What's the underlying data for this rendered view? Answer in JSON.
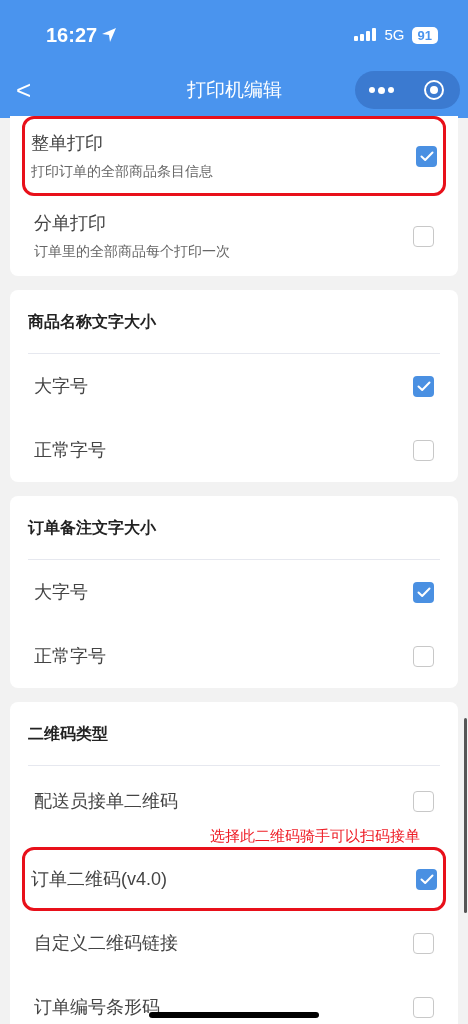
{
  "status_bar": {
    "time": "16:27",
    "network": "5G",
    "battery": "91"
  },
  "nav": {
    "back": "<",
    "title": "打印机编辑"
  },
  "sections": [
    {
      "options": [
        {
          "label": "整单打印",
          "description": "打印订单的全部商品条目信息",
          "checked": true,
          "highlighted": true
        },
        {
          "label": "分单打印",
          "description": "订单里的全部商品每个打印一次",
          "checked": false,
          "highlighted": false
        }
      ]
    },
    {
      "title": "商品名称文字大小",
      "options": [
        {
          "label": "大字号",
          "checked": true,
          "highlighted": false
        },
        {
          "label": "正常字号",
          "checked": false,
          "highlighted": false
        }
      ]
    },
    {
      "title": "订单备注文字大小",
      "options": [
        {
          "label": "大字号",
          "checked": true,
          "highlighted": false
        },
        {
          "label": "正常字号",
          "checked": false,
          "highlighted": false
        }
      ]
    },
    {
      "title": "二维码类型",
      "options": [
        {
          "label": "配送员接单二维码",
          "checked": false,
          "highlighted": false,
          "note": "选择此二维码骑手可以扫码接单"
        },
        {
          "label": "订单二维码(v4.0)",
          "checked": true,
          "highlighted": true
        },
        {
          "label": "自定义二维码链接",
          "checked": false,
          "highlighted": false
        },
        {
          "label": "订单编号条形码",
          "checked": false,
          "highlighted": false
        }
      ]
    }
  ]
}
